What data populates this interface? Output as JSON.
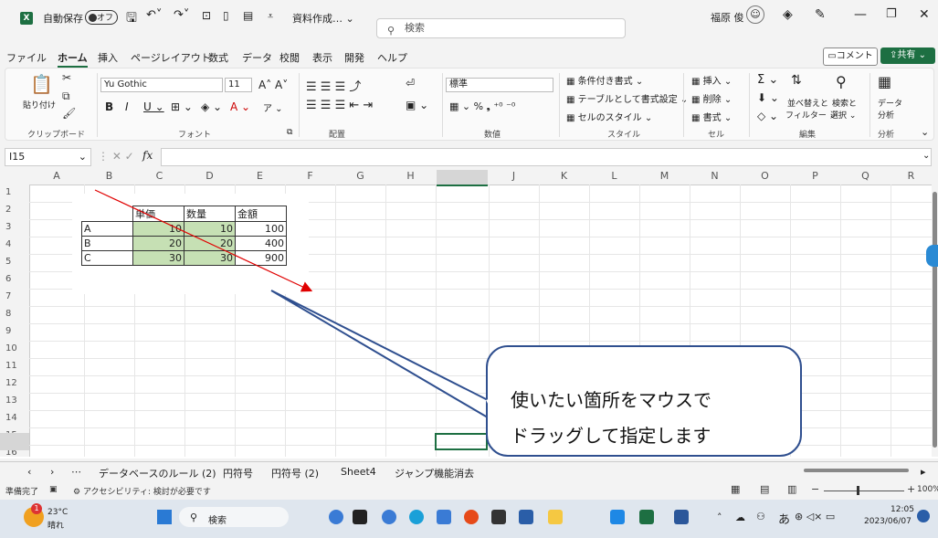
{
  "titlebar": {
    "autosave_label": "自動保存",
    "autosave_state": "オフ",
    "filename": "資料作成…",
    "search_placeholder": "検索",
    "user_name": "福原 俊"
  },
  "menu": {
    "items": [
      "ファイル",
      "ホーム",
      "挿入",
      "ページレイアウト",
      "数式",
      "データ",
      "校閲",
      "表示",
      "開発",
      "ヘルプ"
    ],
    "comment": "コメント",
    "share": "共有"
  },
  "ribbon": {
    "clipboard": {
      "paste": "貼り付け",
      "label": "クリップボード"
    },
    "font": {
      "name": "Yu Gothic",
      "size": "11",
      "label": "フォント"
    },
    "alignment": {
      "label": "配置"
    },
    "number": {
      "format": "標準",
      "label": "数値"
    },
    "styles": {
      "cond": "条件付き書式",
      "table": "テーブルとして書式設定",
      "cell": "セルのスタイル",
      "label": "スタイル"
    },
    "cells": {
      "insert": "挿入",
      "delete": "削除",
      "format": "書式",
      "label": "セル"
    },
    "editing": {
      "sort": "並べ替えと",
      "filter": "フィルター",
      "find": "検索と",
      "select": "選択",
      "label": "編集"
    },
    "analysis": {
      "data": "データ",
      "analyze": "分析",
      "label": "分析"
    }
  },
  "formula": {
    "cell_ref": "I15",
    "fx": "fx"
  },
  "grid": {
    "columns": [
      "A",
      "B",
      "C",
      "D",
      "E",
      "F",
      "G",
      "H",
      "I",
      "J",
      "K",
      "L",
      "M",
      "N",
      "O",
      "P",
      "Q",
      "R"
    ],
    "rows": [
      "1",
      "2",
      "3",
      "4",
      "5",
      "6",
      "7",
      "8",
      "9",
      "10",
      "11",
      "12",
      "13",
      "14",
      "15",
      "16"
    ]
  },
  "table": {
    "headers": [
      "",
      "単価",
      "数量",
      "金額"
    ],
    "rows": [
      [
        "A",
        "10",
        "10",
        "100"
      ],
      [
        "B",
        "20",
        "20",
        "400"
      ],
      [
        "C",
        "30",
        "30",
        "900"
      ]
    ]
  },
  "callout": {
    "line1": "使いたい箇所をマウスで",
    "line2": "ドラッグして指定します"
  },
  "sheets": [
    "データベースのルール (2)",
    "円符号",
    "円符号 (2)",
    "Sheet4",
    "ジャンプ機能消去"
  ],
  "status": {
    "ready": "準備完了",
    "accessibility": "アクセシビリティ: 検討が必要です",
    "zoom": "100%"
  },
  "taskbar": {
    "temp": "23°C",
    "weather": "晴れ",
    "search": "検索",
    "ime": "あ",
    "time": "12:05",
    "date": "2023/06/07"
  }
}
